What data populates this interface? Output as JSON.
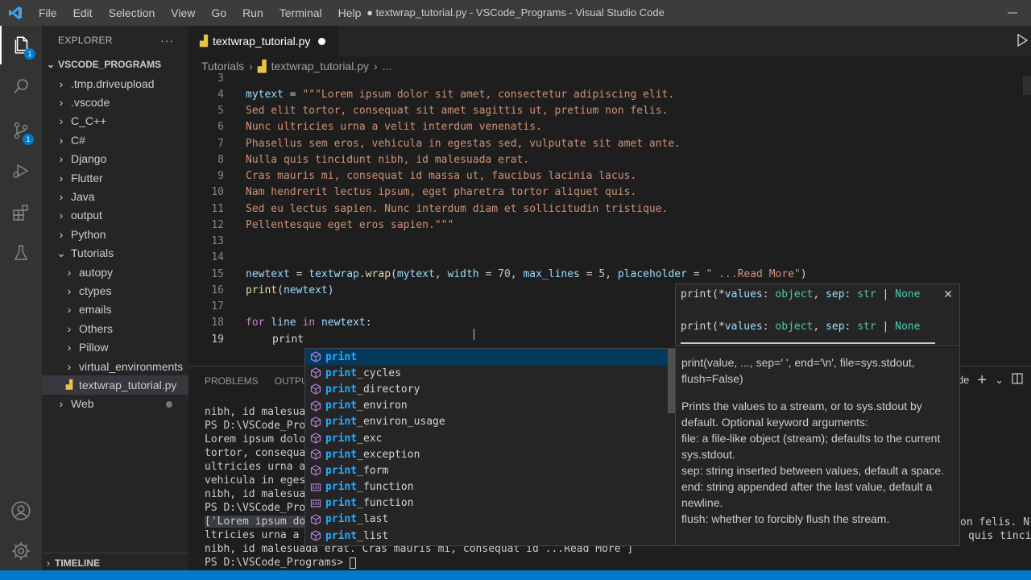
{
  "titlebar": {
    "menu": [
      "File",
      "Edit",
      "Selection",
      "View",
      "Go",
      "Run",
      "Terminal",
      "Help"
    ],
    "window_title": "● textwrap_tutorial.py - VSCode_Programs - Visual Studio Code"
  },
  "activity_bar": {
    "explorer_badge": "1",
    "scm_badge": "1"
  },
  "sidebar": {
    "header": "EXPLORER",
    "more": "···",
    "section": "VSCODE_PROGRAMS",
    "items": [
      {
        "label": ".tmp.driveupload",
        "type": "folder"
      },
      {
        "label": ".vscode",
        "type": "folder"
      },
      {
        "label": "C_C++",
        "type": "folder"
      },
      {
        "label": "C#",
        "type": "folder"
      },
      {
        "label": "Django",
        "type": "folder"
      },
      {
        "label": "Flutter",
        "type": "folder"
      },
      {
        "label": "Java",
        "type": "folder"
      },
      {
        "label": "output",
        "type": "folder"
      },
      {
        "label": "Python",
        "type": "folder"
      },
      {
        "label": "Tutorials",
        "type": "folder-open"
      },
      {
        "label": "autopy",
        "type": "subfolder"
      },
      {
        "label": "ctypes",
        "type": "subfolder"
      },
      {
        "label": "emails",
        "type": "subfolder"
      },
      {
        "label": "Others",
        "type": "subfolder"
      },
      {
        "label": "Pillow",
        "type": "subfolder"
      },
      {
        "label": "virtual_environments",
        "type": "subfolder"
      },
      {
        "label": "textwrap_tutorial.py",
        "type": "file"
      },
      {
        "label": "Web",
        "type": "folder"
      }
    ],
    "timeline": "TIMELINE"
  },
  "tab": {
    "label": "textwrap_tutorial.py"
  },
  "breadcrumbs": [
    "Tutorials",
    "›",
    "textwrap_tutorial.py",
    "›",
    "..."
  ],
  "editor": {
    "line_numbers": [
      "3",
      "4",
      "5",
      "6",
      "7",
      "8",
      "9",
      "10",
      "11",
      "12",
      "13",
      "14",
      "15",
      "16",
      "17",
      "18",
      "19"
    ],
    "code": {
      "l4": "\"\"\"Lorem ipsum dolor sit amet, consectetur adipiscing elit.",
      "l5": "Sed elit tortor, consequat sit amet sagittis ut, pretium non felis.",
      "l6": "Nunc ultricies urna a velit interdum venenatis.",
      "l7": "Phasellus sem eros, vehicula in egestas sed, vulputate sit amet ante.",
      "l8": "Nulla quis tincidunt nibh, id malesuada erat.",
      "l9": "Cras mauris mi, consequat id massa ut, faucibus lacinia lacus.",
      "l10": "Nam hendrerit lectus ipsum, eget pharetra tortor aliquet quis.",
      "l11": "Sed eu lectus sapien. Nunc interdum diam et sollicitudin tristique.",
      "l12": "Pellentesque eget eros sapien.\"\"\"",
      "l15_str": "\" ...Read More\"",
      "mytext": "mytext",
      "newtext": "newtext",
      "textwrap": "textwrap",
      "wrap": "wrap",
      "width": "width",
      "max_lines": "max_lines",
      "placeholder": "placeholder",
      "n70": "70",
      "n5": "5",
      "print": "print",
      "for": "for",
      "in": "in",
      "line": "line"
    }
  },
  "panel": {
    "tabs": [
      "PROBLEMS",
      "OUTPUT"
    ],
    "terminal_label": "de",
    "terminal_lines": [
      "nibh, id malesua",
      "PS D:\\VSCode_Pro",
      "Lorem ipsum dolo",
      "tortor, consequa",
      "ultricies urna a",
      "vehicula in eges",
      "nibh, id malesua",
      "PS D:\\VSCode_Pro",
      "['Lorem ipsum do",
      "ltricies urna a",
      "nibh, id malesuada erat. Cras mauris mi, consequat id ...Read More']",
      "PS D:\\VSCode_Programs> "
    ],
    "terminal_right": [
      "on felis. N",
      "quis tinci"
    ]
  },
  "suggest": {
    "typed": "print",
    "items": [
      {
        "match": "print",
        "rest": "",
        "kind": "module"
      },
      {
        "match": "print",
        "rest": "_cycles",
        "kind": "module"
      },
      {
        "match": "print",
        "rest": "_directory",
        "kind": "module"
      },
      {
        "match": "print",
        "rest": "_environ",
        "kind": "module"
      },
      {
        "match": "print",
        "rest": "_environ_usage",
        "kind": "module"
      },
      {
        "match": "print",
        "rest": "_exc",
        "kind": "module"
      },
      {
        "match": "print",
        "rest": "_exception",
        "kind": "module"
      },
      {
        "match": "print",
        "rest": "_form",
        "kind": "module"
      },
      {
        "match": "print",
        "rest": "_function",
        "kind": "function"
      },
      {
        "match": "print",
        "rest": "_function",
        "kind": "function"
      },
      {
        "match": "print",
        "rest": "_last",
        "kind": "module"
      },
      {
        "match": "print",
        "rest": "_list",
        "kind": "module"
      }
    ]
  },
  "signature": {
    "open": "print(*",
    "values": "values",
    "colon1": ": ",
    "object": "object",
    "comma": ", ",
    "sep": "sep",
    "colon2": ": ",
    "str": "str",
    "pipe": " | ",
    "none": "None"
  },
  "docs": {
    "signature": "print(value, ..., sep=' ', end='\\n', file=sys.stdout, flush=False)",
    "description": [
      "Prints the values to a stream, or to sys.stdout by default. Optional keyword arguments:",
      "file: a file-like object (stream); defaults to the current sys.stdout.",
      "sep: string inserted between values, default a space.",
      "end: string appended after the last value, default a newline.",
      "flush: whether to forcibly flush the stream."
    ]
  },
  "colors": {
    "accent": "#007acc",
    "string": "#ce9178",
    "variable": "#9cdcfe",
    "function": "#dcdcaa",
    "keyword": "#c586c0",
    "number": "#b5cea8",
    "match": "#2aaaff"
  },
  "icons": {
    "activity": [
      "files-icon",
      "search-icon",
      "source-control-icon",
      "run-debug-icon",
      "extensions-icon",
      "testing-icon",
      "account-icon",
      "settings-gear-icon"
    ]
  }
}
